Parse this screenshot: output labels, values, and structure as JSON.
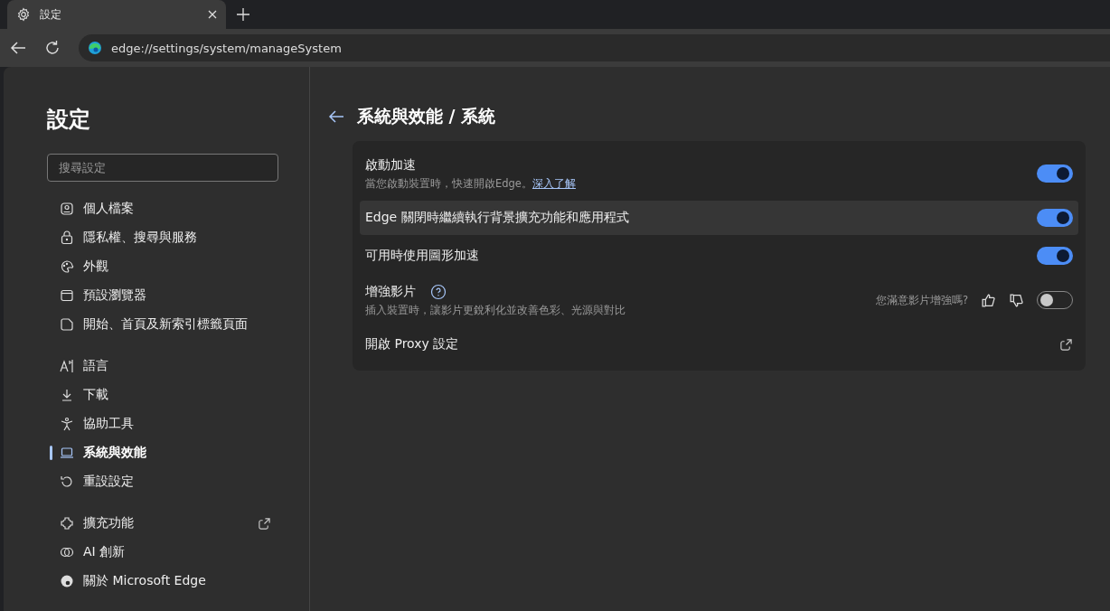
{
  "browser": {
    "tab": {
      "title": "設定"
    },
    "address": "edge://settings/system/manageSystem"
  },
  "sidebar": {
    "title": "設定",
    "search": {
      "placeholder": "搜尋設定"
    },
    "groups": [
      {
        "items": [
          {
            "label": "個人檔案",
            "selected": false
          },
          {
            "label": "隱私權、搜尋與服務",
            "selected": false
          },
          {
            "label": "外觀",
            "selected": false
          },
          {
            "label": "預設瀏覽器",
            "selected": false
          },
          {
            "label": "開始、首頁及新索引標籤頁面",
            "selected": false
          }
        ]
      },
      {
        "items": [
          {
            "label": "語言",
            "selected": false
          },
          {
            "label": "下載",
            "selected": false
          },
          {
            "label": "協助工具",
            "selected": false
          },
          {
            "label": "系統與效能",
            "selected": true
          },
          {
            "label": "重設設定",
            "selected": false
          }
        ]
      },
      {
        "items": [
          {
            "label": "擴充功能",
            "selected": false,
            "external": true
          },
          {
            "label": "AI 創新",
            "selected": false
          },
          {
            "label": "關於 Microsoft Edge",
            "selected": false
          }
        ]
      }
    ]
  },
  "main": {
    "breadcrumb": "系統與效能 / 系統",
    "settings": [
      {
        "kind": "toggle",
        "label": "啟動加速",
        "description": "當您啟動裝置時，快速開啟Edge。",
        "link": "深入了解",
        "on": true,
        "hovered": false
      },
      {
        "kind": "toggle",
        "label": "Edge 關閉時繼續執行背景擴充功能和應用程式",
        "on": true,
        "hovered": true
      },
      {
        "kind": "toggle",
        "label": "可用時使用圖形加速",
        "on": true,
        "hovered": false
      },
      {
        "kind": "feedback_toggle",
        "label": "增強影片",
        "description": "插入裝置時，讓影片更銳利化並改善色彩、光源與對比",
        "feedback": "您滿意影片增強嗎?",
        "on": false,
        "hovered": false
      },
      {
        "kind": "external",
        "label": "開啟 Proxy 設定",
        "hovered": false
      }
    ]
  }
}
